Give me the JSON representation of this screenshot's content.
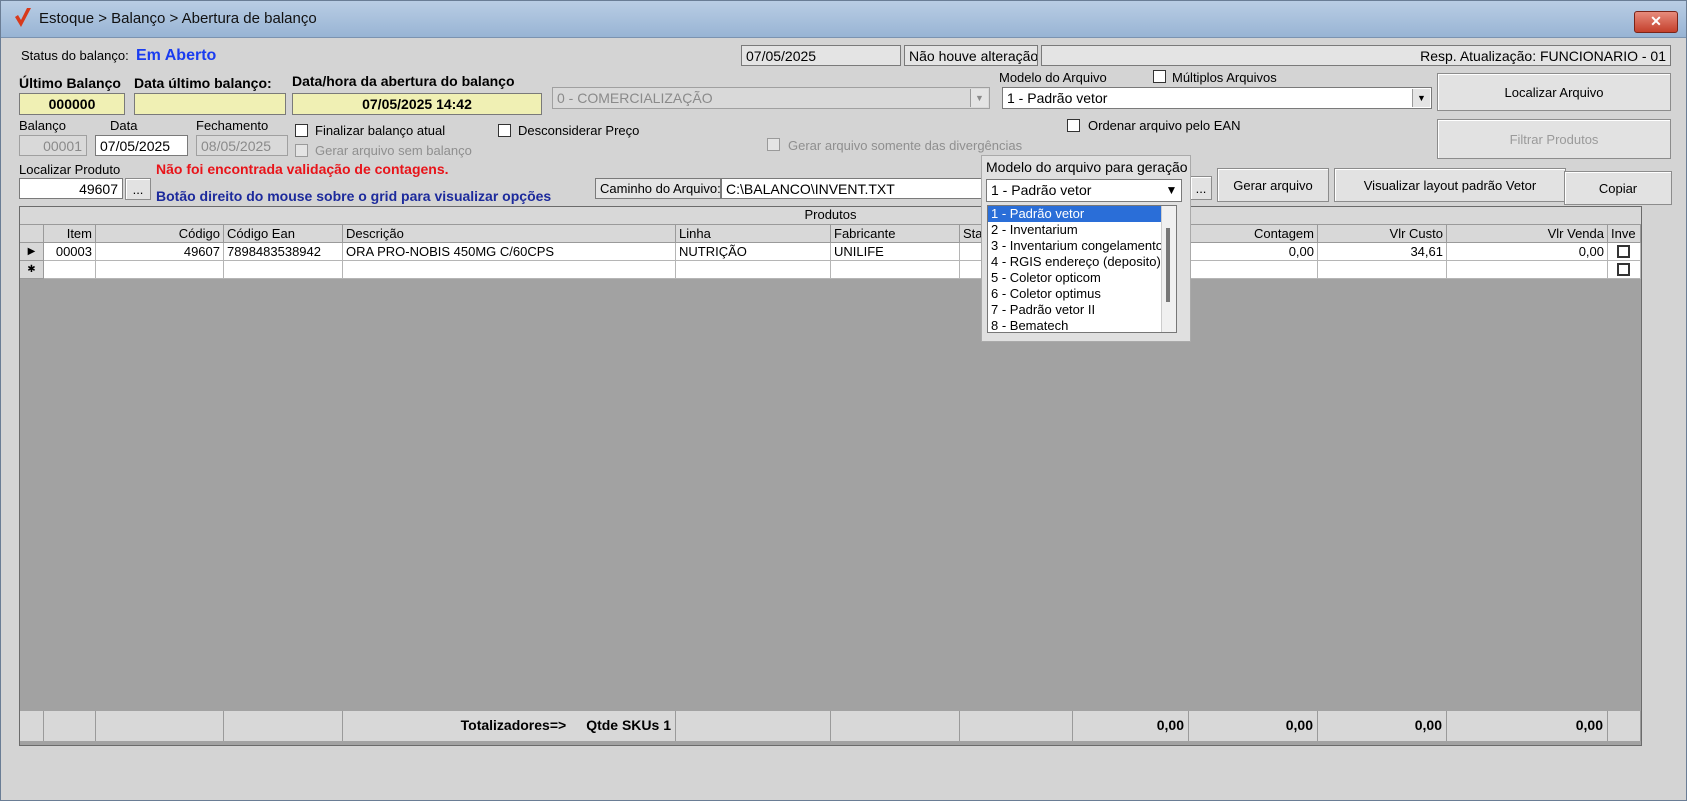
{
  "window": {
    "title": "Estoque > Balanço > Abertura de balanço",
    "close": "✕"
  },
  "status": {
    "label": "Status do balanço:",
    "value": "Em Aberto",
    "date": "07/05/2025",
    "change": "Não houve alteração",
    "resp": "Resp. Atualização: FUNCIONARIO - 01"
  },
  "ultimo": {
    "label": "Último Balanço",
    "value": "000000"
  },
  "data_ultimo": {
    "label": "Data último balanço:",
    "value": ""
  },
  "abertura": {
    "label": "Data/hora da abertura do balanço",
    "value": "07/05/2025 14:42"
  },
  "comercializacao": "0 - COMERCIALIZAÇÃO",
  "modelo": {
    "label": "Modelo do Arquivo",
    "value": "1 - Padrão vetor"
  },
  "multiplos": "Múltiplos Arquivos",
  "ordenar_ean": "Ordenar arquivo pelo EAN",
  "buttons": {
    "localizar": "Localizar Arquivo",
    "filtrar": "Filtrar Produtos",
    "gerar": "Gerar arquivo",
    "visualizar": "Visualizar layout padrão Vetor",
    "copiar": "Copiar",
    "dots": "..."
  },
  "balanco": {
    "label": "Balanço",
    "value": "00001"
  },
  "data": {
    "label": "Data",
    "value": "07/05/2025"
  },
  "fechamento": {
    "label": "Fechamento",
    "value": "08/05/2025"
  },
  "checks": {
    "finalizar": "Finalizar balanço atual",
    "gerar_sem": "Gerar arquivo sem balanço",
    "desconsiderar": "Desconsiderar Preço",
    "divergencias": "Gerar arquivo somente das divergências"
  },
  "localizar_produto": {
    "label": "Localizar Produto",
    "value": "49607"
  },
  "messages": {
    "warning": "Não foi encontrada validação de contagens.",
    "hint": "Botão direito do mouse sobre o grid para visualizar opções"
  },
  "caminho": {
    "label": "Caminho do Arquivo:",
    "value": "C:\\BALANCO\\INVENT.TXT"
  },
  "popup": {
    "title": "Modelo do arquivo para geração",
    "selected": "1 - Padrão vetor",
    "options": [
      "1 - Padrão vetor",
      "2 - Inventarium",
      "3 - Inventarium congelamento",
      "4 - RGIS endereço (deposito)",
      "5 - Coletor opticom",
      "6 - Coletor optimus",
      "7 - Padrão vetor II",
      "8 - Bematech"
    ]
  },
  "grid": {
    "caption": "Produtos",
    "headers": {
      "item": "Item",
      "codigo": "Código",
      "ean": "Código Ean",
      "descricao": "Descrição",
      "linha": "Linha",
      "fabricante": "Fabricante",
      "status": "Sta",
      "contagem": "Contagem",
      "custo": "Vlr Custo",
      "venda": "Vlr Venda",
      "inve": "Inve"
    },
    "row": {
      "item": "00003",
      "codigo": "49607",
      "ean": "7898483538942",
      "descricao": "ORA PRO-NOBIS 450MG C/60CPS",
      "linha": "NUTRIÇÃO",
      "fabricante": "UNILIFE",
      "contagem": "0,00",
      "custo": "34,61",
      "venda": "0,00"
    },
    "totals": {
      "label": "Totalizadores=>",
      "skus": "Qtde SKUs 1",
      "t1": "0,00",
      "t2": "0,00",
      "t3": "0,00",
      "t4": "0,00"
    }
  }
}
